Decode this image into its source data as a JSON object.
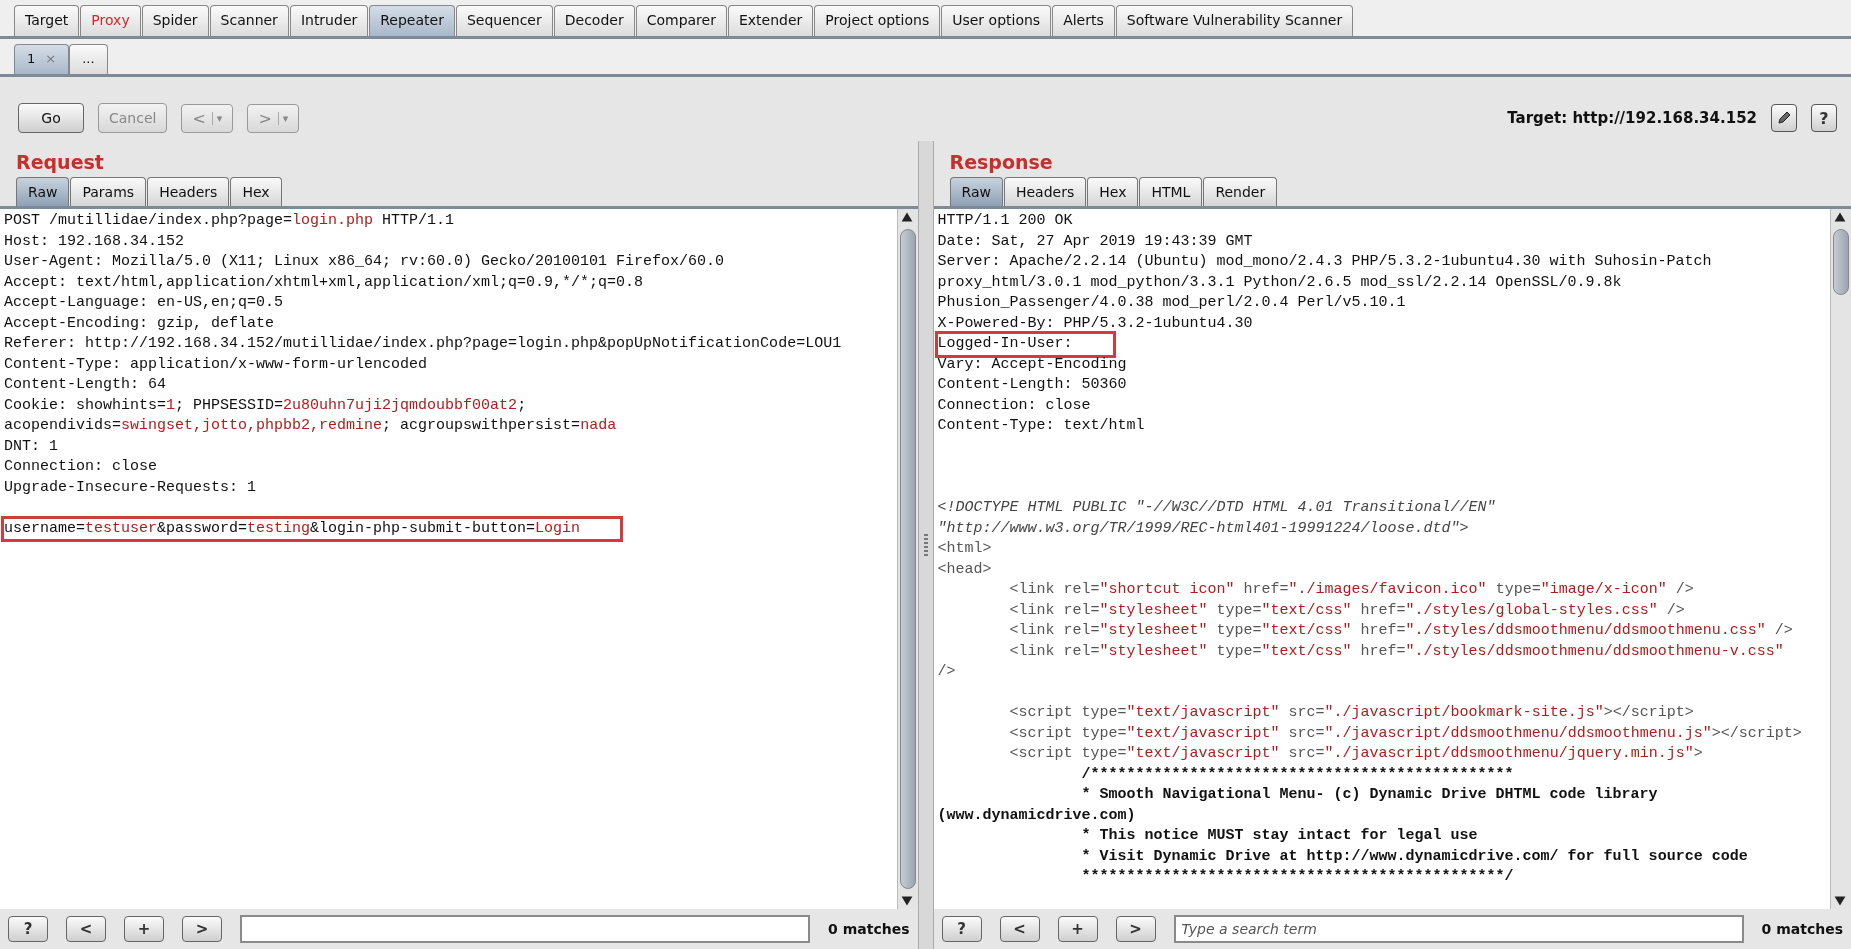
{
  "top_tabs": [
    {
      "label": "Target",
      "selected": false,
      "alert": false
    },
    {
      "label": "Proxy",
      "selected": false,
      "alert": true
    },
    {
      "label": "Spider",
      "selected": false,
      "alert": false
    },
    {
      "label": "Scanner",
      "selected": false,
      "alert": false
    },
    {
      "label": "Intruder",
      "selected": false,
      "alert": false
    },
    {
      "label": "Repeater",
      "selected": true,
      "alert": false
    },
    {
      "label": "Sequencer",
      "selected": false,
      "alert": false
    },
    {
      "label": "Decoder",
      "selected": false,
      "alert": false
    },
    {
      "label": "Comparer",
      "selected": false,
      "alert": false
    },
    {
      "label": "Extender",
      "selected": false,
      "alert": false
    },
    {
      "label": "Project options",
      "selected": false,
      "alert": false
    },
    {
      "label": "User options",
      "selected": false,
      "alert": false
    },
    {
      "label": "Alerts",
      "selected": false,
      "alert": false
    },
    {
      "label": "Software Vulnerability Scanner",
      "selected": false,
      "alert": false
    }
  ],
  "sub_tabs": [
    {
      "label": "1",
      "close": "×",
      "selected": true
    },
    {
      "label": "...",
      "selected": false
    }
  ],
  "toolbar": {
    "buttons": [
      {
        "kind": "text",
        "label": "Go",
        "disabled": false
      },
      {
        "kind": "text",
        "label": "Cancel",
        "disabled": true
      },
      {
        "kind": "nav",
        "arrow": "<",
        "caret": "▾",
        "disabled": true
      },
      {
        "kind": "nav",
        "arrow": ">",
        "caret": "▾",
        "disabled": true
      }
    ],
    "target": "Target: http://192.168.34.152",
    "help": "?"
  },
  "request": {
    "title": "Request",
    "tabs": [
      {
        "label": "Raw",
        "selected": true
      },
      {
        "label": "Params",
        "selected": false
      },
      {
        "label": "Headers",
        "selected": false
      },
      {
        "label": "Hex",
        "selected": false
      }
    ],
    "lines": [
      {
        "kind": "code",
        "highlighted": false,
        "segments": [
          {
            "kind": "text",
            "text": "POST /mutillidae/index.php?page="
          },
          {
            "kind": "value",
            "text": "login.php"
          },
          {
            "kind": "text",
            "text": " HTTP/1.1"
          }
        ]
      },
      {
        "kind": "code",
        "highlighted": false,
        "segments": [
          {
            "kind": "text",
            "text": "Host: 192.168.34.152"
          }
        ]
      },
      {
        "kind": "code",
        "highlighted": false,
        "segments": [
          {
            "kind": "text",
            "text": "User-Agent: Mozilla/5.0 (X11; Linux x86_64; rv:60.0) Gecko/20100101 Firefox/60.0"
          }
        ]
      },
      {
        "kind": "code",
        "highlighted": false,
        "segments": [
          {
            "kind": "text",
            "text": "Accept: text/html,application/xhtml+xml,application/xml;q=0.9,*/*;q=0.8"
          }
        ]
      },
      {
        "kind": "code",
        "highlighted": false,
        "segments": [
          {
            "kind": "text",
            "text": "Accept-Language: en-US,en;q=0.5"
          }
        ]
      },
      {
        "kind": "code",
        "highlighted": false,
        "segments": [
          {
            "kind": "text",
            "text": "Accept-Encoding: gzip, deflate"
          }
        ]
      },
      {
        "kind": "code",
        "highlighted": false,
        "segments": [
          {
            "kind": "text",
            "text": "Referer: http://192.168.34.152/mutillidae/index.php?page=login.php&popUpNotificationCode=LOU1"
          }
        ]
      },
      {
        "kind": "code",
        "highlighted": false,
        "segments": [
          {
            "kind": "text",
            "text": "Content-Type: application/x-www-form-urlencoded"
          }
        ]
      },
      {
        "kind": "code",
        "highlighted": false,
        "segments": [
          {
            "kind": "text",
            "text": "Content-Length: 64"
          }
        ]
      },
      {
        "kind": "code",
        "highlighted": false,
        "segments": [
          {
            "kind": "text",
            "text": "Cookie: showhints="
          },
          {
            "kind": "value",
            "text": "1"
          },
          {
            "kind": "text",
            "text": "; PHPSESSID="
          },
          {
            "kind": "value",
            "text": "2u80uhn7uji2jqmdoubbf00at2"
          },
          {
            "kind": "text",
            "text": ";"
          }
        ]
      },
      {
        "kind": "code",
        "highlighted": false,
        "segments": [
          {
            "kind": "text",
            "text": "acopendivids="
          },
          {
            "kind": "value",
            "text": "swingset,jotto,phpbb2,redmine"
          },
          {
            "kind": "text",
            "text": "; acgroupswithpersist="
          },
          {
            "kind": "value",
            "text": "nada"
          }
        ]
      },
      {
        "kind": "code",
        "highlighted": false,
        "segments": [
          {
            "kind": "text",
            "text": "DNT: 1"
          }
        ]
      },
      {
        "kind": "code",
        "highlighted": false,
        "segments": [
          {
            "kind": "text",
            "text": "Connection: close"
          }
        ]
      },
      {
        "kind": "code",
        "highlighted": false,
        "segments": [
          {
            "kind": "text",
            "text": "Upgrade-Insecure-Requests: 1"
          }
        ]
      },
      {
        "kind": "blank"
      },
      {
        "kind": "code",
        "highlighted": true,
        "segments": [
          {
            "kind": "text",
            "text": "username="
          },
          {
            "kind": "value",
            "text": "testuser"
          },
          {
            "kind": "text",
            "text": "&password="
          },
          {
            "kind": "value",
            "text": "testing"
          },
          {
            "kind": "text",
            "text": "&login-php-submit-button="
          },
          {
            "kind": "value",
            "text": "Login"
          }
        ]
      }
    ],
    "search": {
      "buttons": [
        "?",
        "<",
        "+",
        ">"
      ],
      "matches": "0 matches"
    }
  },
  "response": {
    "title": "Response",
    "tabs": [
      {
        "label": "Raw",
        "selected": true
      },
      {
        "label": "Headers",
        "selected": false
      },
      {
        "label": "Hex",
        "selected": false
      },
      {
        "label": "HTML",
        "selected": false
      },
      {
        "label": "Render",
        "selected": false
      }
    ],
    "lines": [
      {
        "kind": "code",
        "highlighted": false,
        "segments": [
          {
            "kind": "text",
            "text": "HTTP/1.1 200 OK"
          }
        ]
      },
      {
        "kind": "code",
        "highlighted": false,
        "segments": [
          {
            "kind": "text",
            "text": "Date: Sat, 27 Apr 2019 19:43:39 GMT"
          }
        ]
      },
      {
        "kind": "code",
        "highlighted": false,
        "segments": [
          {
            "kind": "text",
            "text": "Server: Apache/2.2.14 (Ubuntu) mod_mono/2.4.3 PHP/5.3.2-1ubuntu4.30 with Suhosin-Patch"
          }
        ]
      },
      {
        "kind": "code",
        "highlighted": false,
        "segments": [
          {
            "kind": "text",
            "text": "proxy_html/3.0.1 mod_python/3.3.1 Python/2.6.5 mod_ssl/2.2.14 OpenSSL/0.9.8k"
          }
        ]
      },
      {
        "kind": "code",
        "highlighted": false,
        "segments": [
          {
            "kind": "text",
            "text": "Phusion_Passenger/4.0.38 mod_perl/2.0.4 Perl/v5.10.1"
          }
        ]
      },
      {
        "kind": "code",
        "highlighted": false,
        "segments": [
          {
            "kind": "text",
            "text": "X-Powered-By: PHP/5.3.2-1ubuntu4.30"
          }
        ]
      },
      {
        "kind": "code",
        "highlighted": true,
        "segments": [
          {
            "kind": "text",
            "text": "Logged-In-User:"
          }
        ]
      },
      {
        "kind": "code",
        "highlighted": false,
        "segments": [
          {
            "kind": "text",
            "text": "Vary: Accept-Encoding"
          }
        ]
      },
      {
        "kind": "code",
        "highlighted": false,
        "segments": [
          {
            "kind": "text",
            "text": "Content-Length: 50360"
          }
        ]
      },
      {
        "kind": "code",
        "highlighted": false,
        "segments": [
          {
            "kind": "text",
            "text": "Connection: close"
          }
        ]
      },
      {
        "kind": "code",
        "highlighted": false,
        "segments": [
          {
            "kind": "text",
            "text": "Content-Type: text/html"
          }
        ]
      },
      {
        "kind": "blank"
      },
      {
        "kind": "blank"
      },
      {
        "kind": "blank"
      },
      {
        "kind": "code",
        "highlighted": false,
        "segments": [
          {
            "kind": "italic",
            "text": "<!DOCTYPE HTML PUBLIC \"-//W3C//DTD HTML 4.01 Transitional//EN\""
          }
        ]
      },
      {
        "kind": "code",
        "highlighted": false,
        "segments": [
          {
            "kind": "italic",
            "text": "\"http://www.w3.org/TR/1999/REC-html401-19991224/loose.dtd\">"
          }
        ]
      },
      {
        "kind": "code",
        "highlighted": false,
        "segments": [
          {
            "kind": "tag",
            "text": "<html>"
          }
        ]
      },
      {
        "kind": "code",
        "highlighted": false,
        "segments": [
          {
            "kind": "tag",
            "text": "<head>"
          }
        ]
      },
      {
        "kind": "code",
        "highlighted": false,
        "segments": [
          {
            "kind": "tag",
            "text": "\t<link rel="
          },
          {
            "kind": "value",
            "text": "\"shortcut icon\""
          },
          {
            "kind": "tag",
            "text": " href="
          },
          {
            "kind": "value",
            "text": "\"./images/favicon.ico\""
          },
          {
            "kind": "tag",
            "text": " type="
          },
          {
            "kind": "value",
            "text": "\"image/x-icon\""
          },
          {
            "kind": "tag",
            "text": " />"
          }
        ]
      },
      {
        "kind": "code",
        "highlighted": false,
        "segments": [
          {
            "kind": "tag",
            "text": "\t<link rel="
          },
          {
            "kind": "value",
            "text": "\"stylesheet\""
          },
          {
            "kind": "tag",
            "text": " type="
          },
          {
            "kind": "value",
            "text": "\"text/css\""
          },
          {
            "kind": "tag",
            "text": " href="
          },
          {
            "kind": "value",
            "text": "\"./styles/global-styles.css\""
          },
          {
            "kind": "tag",
            "text": " />"
          }
        ]
      },
      {
        "kind": "code",
        "highlighted": false,
        "segments": [
          {
            "kind": "tag",
            "text": "\t<link rel="
          },
          {
            "kind": "value",
            "text": "\"stylesheet\""
          },
          {
            "kind": "tag",
            "text": " type="
          },
          {
            "kind": "value",
            "text": "\"text/css\""
          },
          {
            "kind": "tag",
            "text": " href="
          },
          {
            "kind": "value",
            "text": "\"./styles/ddsmoothmenu/ddsmoothmenu.css\""
          },
          {
            "kind": "tag",
            "text": " />"
          }
        ]
      },
      {
        "kind": "code",
        "highlighted": false,
        "segments": [
          {
            "kind": "tag",
            "text": "\t<link rel="
          },
          {
            "kind": "value",
            "text": "\"stylesheet\""
          },
          {
            "kind": "tag",
            "text": " type="
          },
          {
            "kind": "value",
            "text": "\"text/css\""
          },
          {
            "kind": "tag",
            "text": " href="
          },
          {
            "kind": "value",
            "text": "\"./styles/ddsmoothmenu/ddsmoothmenu-v.css\""
          }
        ]
      },
      {
        "kind": "code",
        "highlighted": false,
        "segments": [
          {
            "kind": "tag",
            "text": "/>"
          }
        ]
      },
      {
        "kind": "blank"
      },
      {
        "kind": "code",
        "highlighted": false,
        "segments": [
          {
            "kind": "tag",
            "text": "\t<script type="
          },
          {
            "kind": "value",
            "text": "\"text/javascript\""
          },
          {
            "kind": "tag",
            "text": " src="
          },
          {
            "kind": "value",
            "text": "\"./javascript/bookmark-site.js\""
          },
          {
            "kind": "tag",
            "text": "></script>"
          }
        ]
      },
      {
        "kind": "code",
        "highlighted": false,
        "segments": [
          {
            "kind": "tag",
            "text": "\t<script type="
          },
          {
            "kind": "value",
            "text": "\"text/javascript\""
          },
          {
            "kind": "tag",
            "text": " src="
          },
          {
            "kind": "value",
            "text": "\"./javascript/ddsmoothmenu/ddsmoothmenu.js\""
          },
          {
            "kind": "tag",
            "text": "></script>"
          }
        ]
      },
      {
        "kind": "code",
        "highlighted": false,
        "segments": [
          {
            "kind": "tag",
            "text": "\t<script type="
          },
          {
            "kind": "value",
            "text": "\"text/javascript\""
          },
          {
            "kind": "tag",
            "text": " src="
          },
          {
            "kind": "value",
            "text": "\"./javascript/ddsmoothmenu/jquery.min.js\""
          },
          {
            "kind": "tag",
            "text": ">"
          }
        ]
      },
      {
        "kind": "code",
        "highlighted": false,
        "segments": [
          {
            "kind": "bold",
            "text": "\t\t/***********************************************"
          }
        ]
      },
      {
        "kind": "code",
        "highlighted": false,
        "segments": [
          {
            "kind": "bold",
            "text": "\t\t* Smooth Navigational Menu- (c) Dynamic Drive DHTML code library"
          }
        ]
      },
      {
        "kind": "code",
        "highlighted": false,
        "segments": [
          {
            "kind": "bold",
            "text": "(www.dynamicdrive.com)"
          }
        ]
      },
      {
        "kind": "code",
        "highlighted": false,
        "segments": [
          {
            "kind": "bold",
            "text": "\t\t* This notice MUST stay intact for legal use"
          }
        ]
      },
      {
        "kind": "code",
        "highlighted": false,
        "segments": [
          {
            "kind": "bold",
            "text": "\t\t* Visit Dynamic Drive at http://www.dynamicdrive.com/ for full source code"
          }
        ]
      },
      {
        "kind": "code",
        "highlighted": false,
        "segments": [
          {
            "kind": "bold",
            "text": "\t\t***********************************************/"
          }
        ]
      }
    ],
    "search": {
      "buttons": [
        "?",
        "<",
        "+",
        ">"
      ],
      "placeholder": "Type a search term",
      "matches": "0 matches"
    }
  }
}
